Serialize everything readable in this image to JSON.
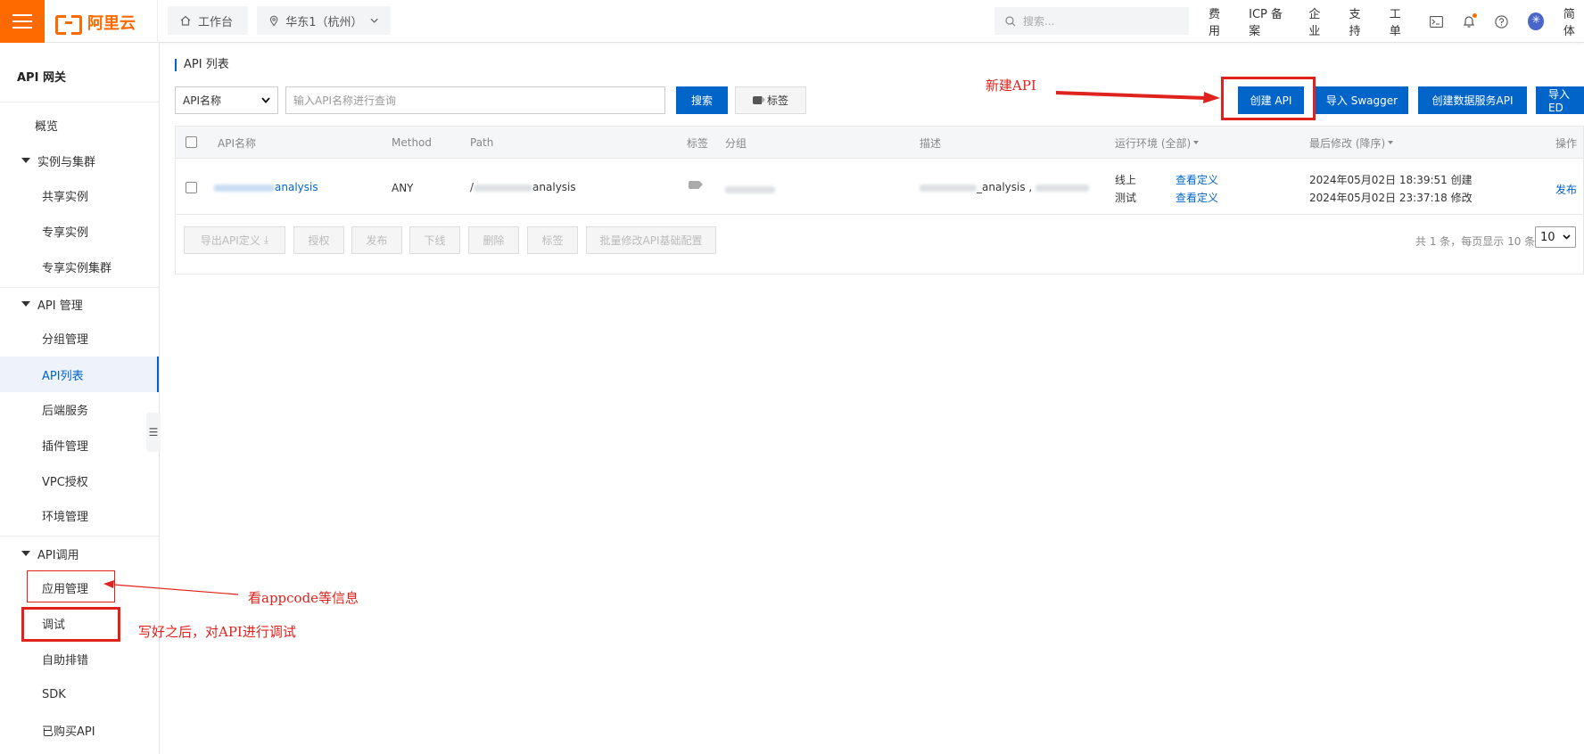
{
  "topbar": {
    "brand": "阿里云",
    "workbench": "工作台",
    "region": "华东1（杭州）",
    "search_placeholder": "搜索...",
    "links": [
      "费用",
      "ICP 备案",
      "企业",
      "支持",
      "工单"
    ],
    "language": "简体"
  },
  "sidebar": {
    "title": "API 网关",
    "overview": "概览",
    "groups": [
      {
        "label": "实例与集群",
        "items": [
          "共享实例",
          "专享实例",
          "专享实例集群"
        ]
      },
      {
        "label": "API 管理",
        "items": [
          "分组管理",
          "API列表",
          "后端服务",
          "插件管理",
          "VPC授权",
          "环境管理"
        ]
      },
      {
        "label": "API调用",
        "items": [
          "应用管理",
          "调试",
          "自助排错",
          "SDK",
          "已购买API"
        ]
      }
    ],
    "active_item": "API列表"
  },
  "main": {
    "page_title": "API 列表",
    "filter": {
      "select_value": "API名称",
      "input_placeholder": "输入API名称进行查询",
      "search_button": "搜索",
      "tag_button": "标签"
    },
    "actions": [
      "创建 API",
      "导入 Swagger",
      "创建数据服务API",
      "导入ED"
    ],
    "table": {
      "columns": [
        "API名称",
        "Method",
        "Path",
        "标签",
        "分组",
        "描述",
        "运行环境 (全部)",
        "最后修改 (降序)",
        "操作"
      ],
      "rows": [
        {
          "name_suffix": "analysis",
          "method": "ANY",
          "path_prefix": "/",
          "path_suffix": "analysis",
          "desc_suffix": "_analysis ,",
          "env": [
            {
              "name": "线上",
              "link": "查看定义"
            },
            {
              "name": "测试",
              "link": "查看定义"
            }
          ],
          "modified": [
            "2024年05月02日 18:39:51 创建",
            "2024年05月02日 23:37:18 修改"
          ],
          "op": "发布"
        }
      ]
    },
    "footer_buttons": [
      "导出API定义",
      "授权",
      "发布",
      "下线",
      "删除",
      "标签",
      "批量修改API基础配置"
    ],
    "pager_text": "共 1 条，每页显示 10 条",
    "page_size": "10"
  },
  "annotations": {
    "create_api": "新建API",
    "app_manage": "看appcode等信息",
    "debug": "写好之后，对API进行调试"
  },
  "colors": {
    "brand": "#ff6a00",
    "primary": "#0064c8",
    "annotation": "#e0221c"
  }
}
